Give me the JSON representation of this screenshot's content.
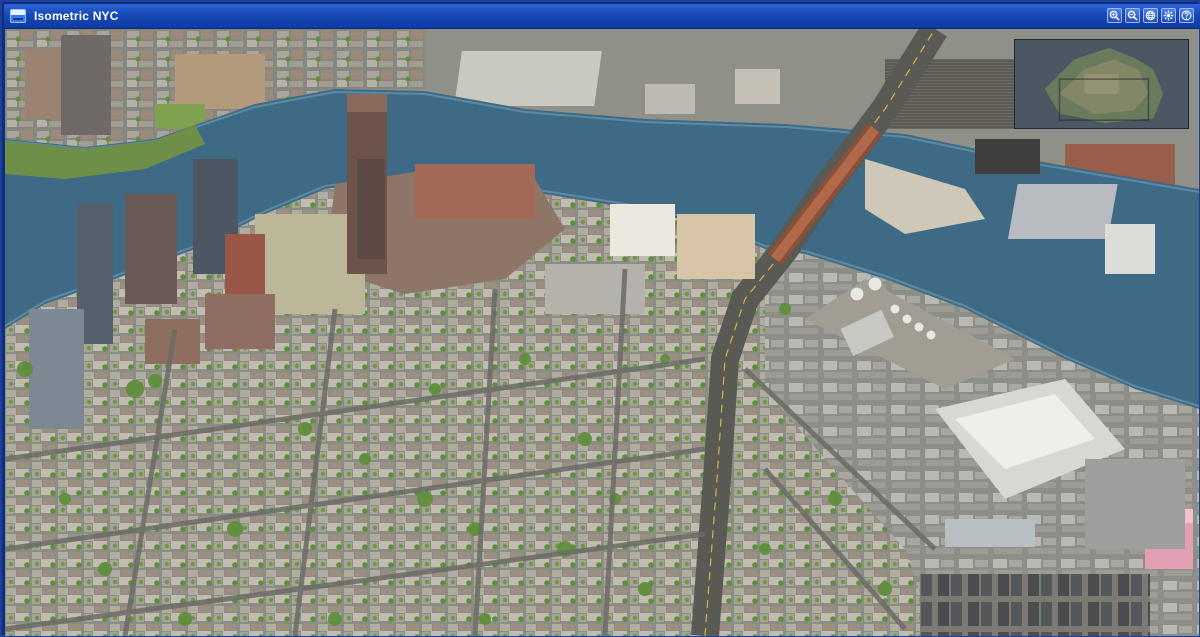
{
  "window": {
    "title": "Isometric NYC"
  },
  "toolbar": {
    "buttons": [
      {
        "name": "zoom-in-button",
        "icon": "zoom-in-icon"
      },
      {
        "name": "zoom-out-button",
        "icon": "zoom-out-icon"
      },
      {
        "name": "globe-button",
        "icon": "globe-icon"
      },
      {
        "name": "settings-button",
        "icon": "gear-icon"
      },
      {
        "name": "help-button",
        "icon": "help-icon"
      }
    ]
  },
  "colors": {
    "titlebar": "#1849b6",
    "water": "#3e6a86",
    "park": "#7c9a4b"
  }
}
